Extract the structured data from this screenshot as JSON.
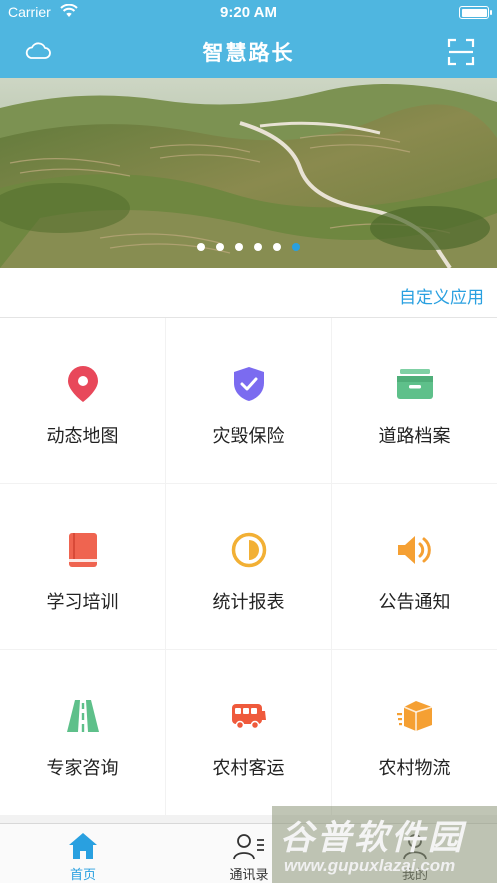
{
  "status_bar": {
    "carrier": "Carrier",
    "time": "9:20 AM"
  },
  "nav": {
    "title": "智慧路长",
    "left_icon": "cloud-icon",
    "right_icon": "scan-icon"
  },
  "banner": {
    "dots_total": 6,
    "active_dot": 6
  },
  "custom_link": "自定义应用",
  "apps": [
    {
      "label": "动态地图",
      "icon": "map-pin-icon",
      "color": "#e8485a"
    },
    {
      "label": "灾毁保险",
      "icon": "shield-check-icon",
      "color": "#7b6bf0"
    },
    {
      "label": "道路档案",
      "icon": "archive-box-icon",
      "color": "#5ec08a"
    },
    {
      "label": "学习培训",
      "icon": "book-icon",
      "color": "#ef6450"
    },
    {
      "label": "统计报表",
      "icon": "pie-chart-icon",
      "color": "#f2b035"
    },
    {
      "label": "公告通知",
      "icon": "speaker-icon",
      "color": "#f5a033"
    },
    {
      "label": "专家咨询",
      "icon": "road-icon",
      "color": "#5ec08a"
    },
    {
      "label": "农村客运",
      "icon": "bus-icon",
      "color": "#ef5a3c"
    },
    {
      "label": "农村物流",
      "icon": "package-icon",
      "color": "#f5a033"
    }
  ],
  "tabs": [
    {
      "label": "首页",
      "icon": "home-icon"
    },
    {
      "label": "通讯录",
      "icon": "contacts-icon"
    },
    {
      "label": "我的",
      "icon": "user-icon"
    }
  ],
  "watermark": {
    "title": "谷普软件园",
    "url": "www.gupuxlazai.com"
  },
  "colors": {
    "primary": "#4fb6e0",
    "link": "#29a0e0"
  }
}
